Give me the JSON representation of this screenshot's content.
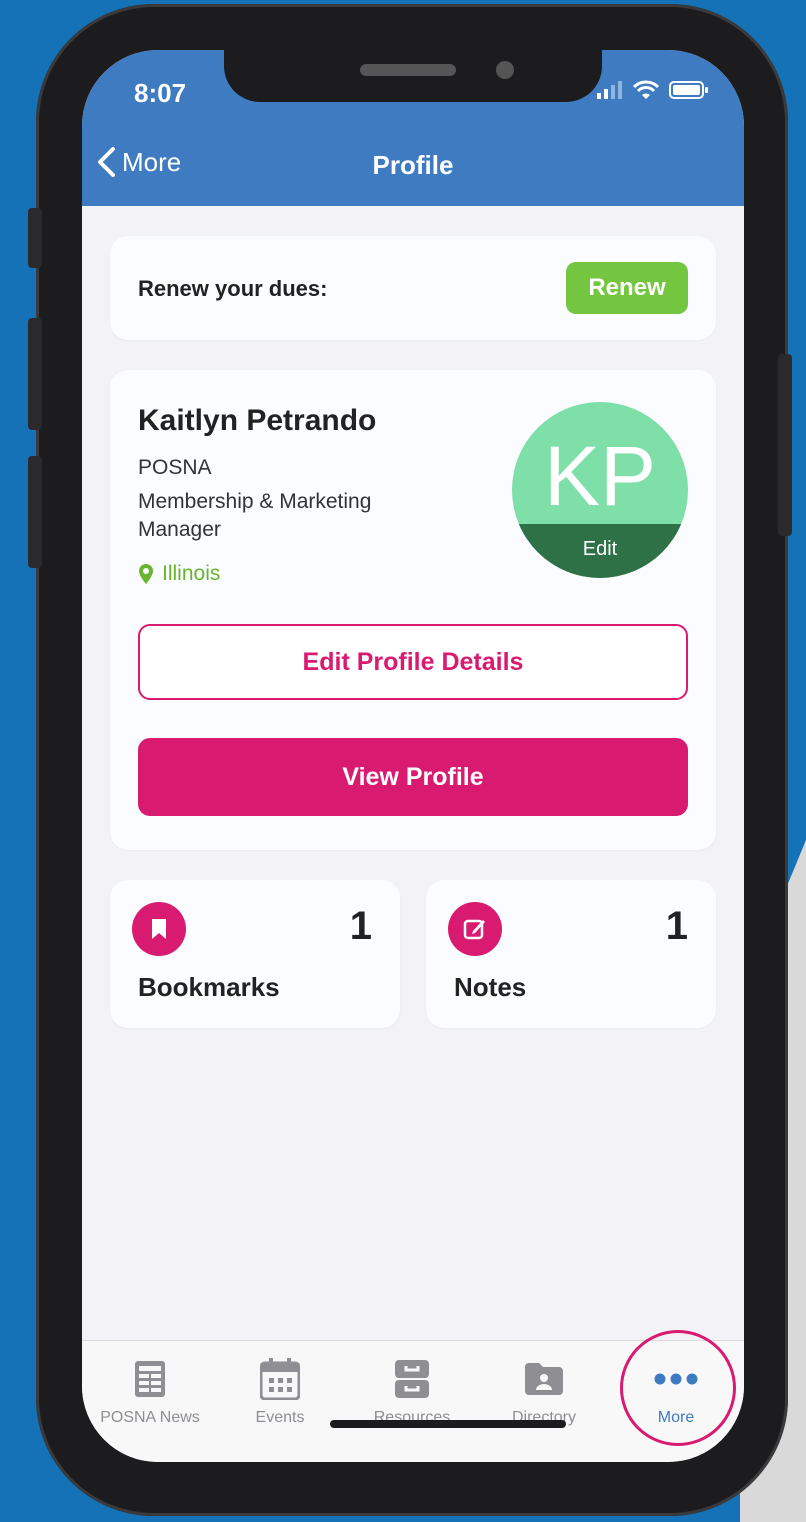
{
  "status_bar": {
    "time": "8:07"
  },
  "nav": {
    "back_label": "More",
    "title": "Profile"
  },
  "renew": {
    "label": "Renew your dues:",
    "button": "Renew"
  },
  "profile": {
    "name": "Kaitlyn Petrando",
    "organization": "POSNA",
    "title": "Membership & Marketing Manager",
    "location": "Illinois",
    "initials": "KP",
    "avatar_edit": "Edit",
    "edit_button": "Edit Profile Details",
    "view_button": "View Profile"
  },
  "stats": {
    "bookmarks": {
      "count": "1",
      "label": "Bookmarks"
    },
    "notes": {
      "count": "1",
      "label": "Notes"
    }
  },
  "tabs": [
    {
      "label": "POSNA News",
      "icon": "newspaper-icon"
    },
    {
      "label": "Events",
      "icon": "calendar-icon"
    },
    {
      "label": "Resources",
      "icon": "archive-icon"
    },
    {
      "label": "Directory",
      "icon": "folder-person-icon"
    },
    {
      "label": "More",
      "icon": "more-icon",
      "active": true
    }
  ],
  "colors": {
    "navbar": "#3f7bc0",
    "accent": "#d81b70",
    "renew": "#74c640",
    "avatar": "#7fdfa8",
    "location": "#69b530"
  }
}
